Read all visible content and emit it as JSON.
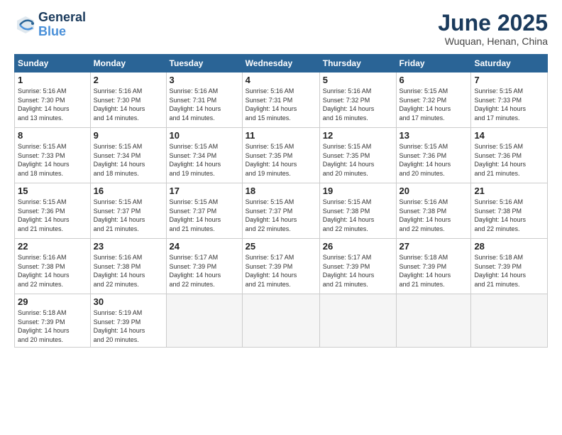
{
  "logo": {
    "line1": "General",
    "line2": "Blue"
  },
  "title": "June 2025",
  "location": "Wuquan, Henan, China",
  "days_of_week": [
    "Sunday",
    "Monday",
    "Tuesday",
    "Wednesday",
    "Thursday",
    "Friday",
    "Saturday"
  ],
  "weeks": [
    [
      {
        "day": "1",
        "info": "Sunrise: 5:16 AM\nSunset: 7:30 PM\nDaylight: 14 hours\nand 13 minutes."
      },
      {
        "day": "2",
        "info": "Sunrise: 5:16 AM\nSunset: 7:30 PM\nDaylight: 14 hours\nand 14 minutes."
      },
      {
        "day": "3",
        "info": "Sunrise: 5:16 AM\nSunset: 7:31 PM\nDaylight: 14 hours\nand 14 minutes."
      },
      {
        "day": "4",
        "info": "Sunrise: 5:16 AM\nSunset: 7:31 PM\nDaylight: 14 hours\nand 15 minutes."
      },
      {
        "day": "5",
        "info": "Sunrise: 5:16 AM\nSunset: 7:32 PM\nDaylight: 14 hours\nand 16 minutes."
      },
      {
        "day": "6",
        "info": "Sunrise: 5:15 AM\nSunset: 7:32 PM\nDaylight: 14 hours\nand 17 minutes."
      },
      {
        "day": "7",
        "info": "Sunrise: 5:15 AM\nSunset: 7:33 PM\nDaylight: 14 hours\nand 17 minutes."
      }
    ],
    [
      {
        "day": "8",
        "info": "Sunrise: 5:15 AM\nSunset: 7:33 PM\nDaylight: 14 hours\nand 18 minutes."
      },
      {
        "day": "9",
        "info": "Sunrise: 5:15 AM\nSunset: 7:34 PM\nDaylight: 14 hours\nand 18 minutes."
      },
      {
        "day": "10",
        "info": "Sunrise: 5:15 AM\nSunset: 7:34 PM\nDaylight: 14 hours\nand 19 minutes."
      },
      {
        "day": "11",
        "info": "Sunrise: 5:15 AM\nSunset: 7:35 PM\nDaylight: 14 hours\nand 19 minutes."
      },
      {
        "day": "12",
        "info": "Sunrise: 5:15 AM\nSunset: 7:35 PM\nDaylight: 14 hours\nand 20 minutes."
      },
      {
        "day": "13",
        "info": "Sunrise: 5:15 AM\nSunset: 7:36 PM\nDaylight: 14 hours\nand 20 minutes."
      },
      {
        "day": "14",
        "info": "Sunrise: 5:15 AM\nSunset: 7:36 PM\nDaylight: 14 hours\nand 21 minutes."
      }
    ],
    [
      {
        "day": "15",
        "info": "Sunrise: 5:15 AM\nSunset: 7:36 PM\nDaylight: 14 hours\nand 21 minutes."
      },
      {
        "day": "16",
        "info": "Sunrise: 5:15 AM\nSunset: 7:37 PM\nDaylight: 14 hours\nand 21 minutes."
      },
      {
        "day": "17",
        "info": "Sunrise: 5:15 AM\nSunset: 7:37 PM\nDaylight: 14 hours\nand 21 minutes."
      },
      {
        "day": "18",
        "info": "Sunrise: 5:15 AM\nSunset: 7:37 PM\nDaylight: 14 hours\nand 22 minutes."
      },
      {
        "day": "19",
        "info": "Sunrise: 5:15 AM\nSunset: 7:38 PM\nDaylight: 14 hours\nand 22 minutes."
      },
      {
        "day": "20",
        "info": "Sunrise: 5:16 AM\nSunset: 7:38 PM\nDaylight: 14 hours\nand 22 minutes."
      },
      {
        "day": "21",
        "info": "Sunrise: 5:16 AM\nSunset: 7:38 PM\nDaylight: 14 hours\nand 22 minutes."
      }
    ],
    [
      {
        "day": "22",
        "info": "Sunrise: 5:16 AM\nSunset: 7:38 PM\nDaylight: 14 hours\nand 22 minutes."
      },
      {
        "day": "23",
        "info": "Sunrise: 5:16 AM\nSunset: 7:38 PM\nDaylight: 14 hours\nand 22 minutes."
      },
      {
        "day": "24",
        "info": "Sunrise: 5:17 AM\nSunset: 7:39 PM\nDaylight: 14 hours\nand 22 minutes."
      },
      {
        "day": "25",
        "info": "Sunrise: 5:17 AM\nSunset: 7:39 PM\nDaylight: 14 hours\nand 21 minutes."
      },
      {
        "day": "26",
        "info": "Sunrise: 5:17 AM\nSunset: 7:39 PM\nDaylight: 14 hours\nand 21 minutes."
      },
      {
        "day": "27",
        "info": "Sunrise: 5:18 AM\nSunset: 7:39 PM\nDaylight: 14 hours\nand 21 minutes."
      },
      {
        "day": "28",
        "info": "Sunrise: 5:18 AM\nSunset: 7:39 PM\nDaylight: 14 hours\nand 21 minutes."
      }
    ],
    [
      {
        "day": "29",
        "info": "Sunrise: 5:18 AM\nSunset: 7:39 PM\nDaylight: 14 hours\nand 20 minutes."
      },
      {
        "day": "30",
        "info": "Sunrise: 5:19 AM\nSunset: 7:39 PM\nDaylight: 14 hours\nand 20 minutes."
      },
      {
        "day": "",
        "info": ""
      },
      {
        "day": "",
        "info": ""
      },
      {
        "day": "",
        "info": ""
      },
      {
        "day": "",
        "info": ""
      },
      {
        "day": "",
        "info": ""
      }
    ]
  ]
}
